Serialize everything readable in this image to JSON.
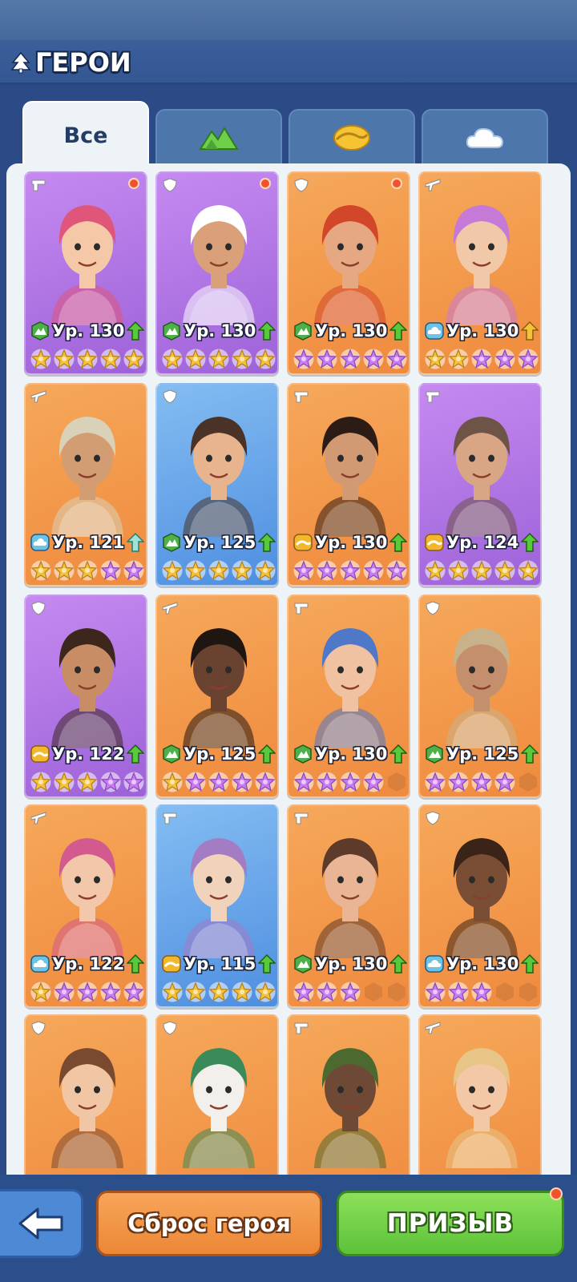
{
  "header": {
    "title": "ГЕРОИ",
    "icon": "tree-icon"
  },
  "tabs": [
    {
      "id": "all",
      "label": "Все",
      "active": true
    },
    {
      "id": "mountain",
      "icon": "mountain-icon",
      "active": false
    },
    {
      "id": "desert",
      "icon": "dune-icon",
      "active": false
    },
    {
      "id": "cloud",
      "icon": "cloud-icon",
      "active": false
    }
  ],
  "colors": {
    "orange_card": "#ef8a3e",
    "purple_card": "#9d62d8",
    "blue_card": "#4e8ee0",
    "gold_star": "#f4c23a",
    "purple_star": "#c77cf2",
    "mountain_badge": "#4fb04a",
    "cloud_badge": "#6cc3e6",
    "dune_badge": "#f1b82d",
    "upgrade_arrow": "#57c93a",
    "notif": "#f0522c"
  },
  "heroes": [
    {
      "name": "hero-pink-hair-girl",
      "bg": "purple",
      "role": "gun-icon",
      "dot": true,
      "element": "mountain",
      "level": "Ур. 130",
      "upgrade": "green",
      "stars": [
        "g",
        "g",
        "g",
        "g",
        "g"
      ],
      "hair": "#e0567a",
      "skin": "#f5c9a8"
    },
    {
      "name": "hero-chef",
      "bg": "purple",
      "role": "shield-icon",
      "dot": true,
      "element": "mountain",
      "level": "Ур. 130",
      "upgrade": "green",
      "stars": [
        "g",
        "g",
        "g",
        "g",
        "g"
      ],
      "hair": "#ffffff",
      "skin": "#d9a07a"
    },
    {
      "name": "hero-red-hair-fighter",
      "bg": "orange",
      "role": "shield-icon",
      "dot": true,
      "element": "mountain",
      "level": "Ур. 130",
      "upgrade": "green",
      "stars": [
        "p",
        "p",
        "p",
        "p",
        "p"
      ],
      "hair": "#d2462a",
      "skin": "#e6a882"
    },
    {
      "name": "hero-beret-girl",
      "bg": "orange",
      "role": "rifle-icon",
      "dot": false,
      "element": "cloud",
      "level": "Ур. 130",
      "upgrade": "gold",
      "stars": [
        "g",
        "g",
        "p",
        "p",
        "p"
      ],
      "hair": "#c67ad8",
      "skin": "#f2c9a8"
    },
    {
      "name": "hero-cap-mechanic",
      "bg": "orange",
      "role": "rifle-icon",
      "dot": false,
      "element": "cloud",
      "level": "Ур. 121",
      "upgrade": "teal",
      "stars": [
        "g",
        "g",
        "g",
        "p",
        "p"
      ],
      "hair": "#d9d2b8",
      "skin": "#d39d74"
    },
    {
      "name": "hero-big-guy",
      "bg": "blue",
      "role": "shield-icon",
      "dot": false,
      "element": "mountain",
      "level": "Ур. 125",
      "upgrade": "green",
      "stars": [
        "g",
        "g",
        "g",
        "g",
        "g"
      ],
      "hair": "#4a3326",
      "skin": "#e7b48e"
    },
    {
      "name": "hero-headband-girl",
      "bg": "orange",
      "role": "gun-icon",
      "dot": false,
      "element": "dune",
      "level": "Ур. 130",
      "upgrade": "green",
      "stars": [
        "p",
        "p",
        "p",
        "p",
        "p"
      ],
      "hair": "#2d1c16",
      "skin": "#d19a72"
    },
    {
      "name": "hero-bearded-old",
      "bg": "purple",
      "role": "gun-icon",
      "dot": false,
      "element": "dune",
      "level": "Ур. 124",
      "upgrade": "green",
      "stars": [
        "g",
        "g",
        "g",
        "g",
        "g"
      ],
      "hair": "#6e5446",
      "skin": "#d8a585"
    },
    {
      "name": "hero-tank-top-girl",
      "bg": "purple",
      "role": "shield-icon",
      "dot": false,
      "element": "dune",
      "level": "Ур. 122",
      "upgrade": "green",
      "stars": [
        "g",
        "g",
        "g",
        "p",
        "p"
      ],
      "hair": "#3d261c",
      "skin": "#c98d66"
    },
    {
      "name": "hero-gold-chain",
      "bg": "orange",
      "role": "rifle-icon",
      "dot": false,
      "element": "mountain",
      "level": "Ур. 125",
      "upgrade": "green",
      "stars": [
        "g",
        "p",
        "p",
        "p",
        "p"
      ],
      "hair": "#1f1612",
      "skin": "#6a4230"
    },
    {
      "name": "hero-rocker-girl",
      "bg": "orange",
      "role": "gun-icon",
      "dot": false,
      "element": "mountain",
      "level": "Ур. 130",
      "upgrade": "green",
      "stars": [
        "p",
        "p",
        "p",
        "p",
        "e"
      ],
      "hair": "#4f78c8",
      "skin": "#f0c2a2"
    },
    {
      "name": "hero-cyborg-cap",
      "bg": "orange",
      "role": "shield-icon",
      "dot": false,
      "element": "mountain",
      "level": "Ур. 125",
      "upgrade": "green",
      "stars": [
        "p",
        "p",
        "p",
        "p",
        "e"
      ],
      "hair": "#c9b28a",
      "skin": "#c38f6c"
    },
    {
      "name": "hero-pigtails-girl",
      "bg": "orange",
      "role": "rifle-icon",
      "dot": false,
      "element": "cloud",
      "level": "Ур. 122",
      "upgrade": "green",
      "stars": [
        "g",
        "p",
        "p",
        "p",
        "p"
      ],
      "hair": "#d25a8e",
      "skin": "#f3c7aa"
    },
    {
      "name": "hero-hoodie-boy",
      "bg": "blue",
      "role": "gun-icon",
      "dot": false,
      "element": "dune",
      "level": "Ур. 115",
      "upgrade": "green",
      "stars": [
        "g",
        "g",
        "g",
        "g",
        "g"
      ],
      "hair": "#a37cc4",
      "skin": "#f1d3bc"
    },
    {
      "name": "hero-fish-hat-girl",
      "bg": "orange",
      "role": "gun-icon",
      "dot": false,
      "element": "mountain",
      "level": "Ур. 130",
      "upgrade": "green",
      "stars": [
        "p",
        "p",
        "p",
        "e",
        "e"
      ],
      "hair": "#5d3a2a",
      "skin": "#eab595"
    },
    {
      "name": "hero-goggles-soldier",
      "bg": "orange",
      "role": "shield-icon",
      "dot": false,
      "element": "cloud",
      "level": "Ур. 130",
      "upgrade": "green",
      "stars": [
        "p",
        "p",
        "p",
        "e",
        "e"
      ],
      "hair": "#3a2418",
      "skin": "#7a4e34"
    },
    {
      "name": "hero-headphones-girl",
      "bg": "orange",
      "role": "shield-icon",
      "dot": false,
      "element": "",
      "level": "",
      "upgrade": "",
      "stars": [],
      "hair": "#7a4a30",
      "skin": "#f0c6a4"
    },
    {
      "name": "hero-joker",
      "bg": "orange",
      "role": "shield-icon",
      "dot": false,
      "element": "",
      "level": "",
      "upgrade": "",
      "stars": [],
      "hair": "#3a8a5a",
      "skin": "#f3f0ec"
    },
    {
      "name": "hero-hooded-man",
      "bg": "orange",
      "role": "gun-icon",
      "dot": false,
      "element": "",
      "level": "",
      "upgrade": "",
      "stars": [],
      "hair": "#4c6a30",
      "skin": "#6e4a36"
    },
    {
      "name": "hero-blonde-gunner",
      "bg": "orange",
      "role": "rifle-icon",
      "dot": false,
      "element": "",
      "level": "",
      "upgrade": "",
      "stars": [],
      "hair": "#e7c586",
      "skin": "#f3c8a6"
    }
  ],
  "footer": {
    "back_icon": "back-arrow-icon",
    "reset_label": "Сброс героя",
    "summon_label": "ПРИЗЫВ",
    "summon_notification": true
  }
}
